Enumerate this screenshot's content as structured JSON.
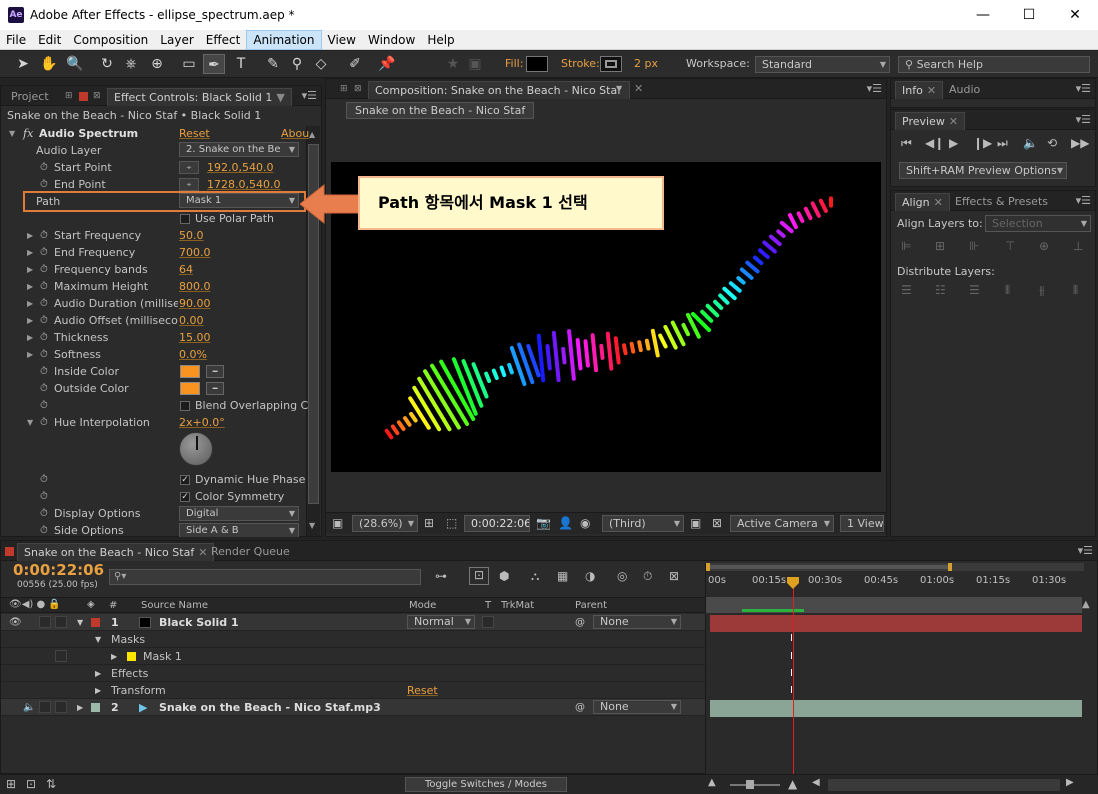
{
  "window": {
    "app_badge": "Ae",
    "title": "Adobe After Effects - ellipse_spectrum.aep *",
    "minimize": "—",
    "maximize": "☐",
    "close": "✕"
  },
  "menu": [
    "File",
    "Edit",
    "Composition",
    "Layer",
    "Effect",
    "Animation",
    "View",
    "Window",
    "Help"
  ],
  "menu_active": "Animation",
  "toolbar": {
    "fill_label": "Fill:",
    "stroke_label": "Stroke:",
    "stroke_width": "2 px",
    "workspace_label": "Workspace:",
    "workspace_value": "Standard",
    "search_placeholder": "Search Help"
  },
  "left_panel": {
    "tab_project": "Project",
    "tab_effect": "Effect Controls: Black Solid 1",
    "breadcrumb": "Snake on the Beach - Nico Staf • Black Solid 1",
    "effect_name": "Audio Spectrum",
    "reset": "Reset",
    "about": "Abou",
    "props": {
      "audio_layer": {
        "label": "Audio Layer",
        "value": "2. Snake on the Be"
      },
      "start_point": {
        "label": "Start Point",
        "value": "192.0,540.0"
      },
      "end_point": {
        "label": "End Point",
        "value": "1728.0,540.0"
      },
      "path": {
        "label": "Path",
        "value": "Mask 1"
      },
      "use_polar": {
        "label": "Use Polar Path"
      },
      "start_freq": {
        "label": "Start Frequency",
        "value": "50.0"
      },
      "end_freq": {
        "label": "End Frequency",
        "value": "700.0"
      },
      "freq_bands": {
        "label": "Frequency bands",
        "value": "64"
      },
      "max_height": {
        "label": "Maximum Height",
        "value": "800.0"
      },
      "audio_duration": {
        "label": "Audio Duration (millisec",
        "value": "90.00"
      },
      "audio_offset": {
        "label": "Audio Offset (millisecon",
        "value": "0.00"
      },
      "thickness": {
        "label": "Thickness",
        "value": "15.00"
      },
      "softness": {
        "label": "Softness",
        "value": "0.0%"
      },
      "inside_color": {
        "label": "Inside Color",
        "color": "#f7931e"
      },
      "outside_color": {
        "label": "Outside Color",
        "color": "#f7931e"
      },
      "blend": {
        "label": "Blend Overlapping C"
      },
      "hue_interp": {
        "label": "Hue Interpolation",
        "value": "2x+0.0°"
      },
      "dynamic_hue": {
        "label": "Dynamic Hue Phase"
      },
      "color_sym": {
        "label": "Color Symmetry"
      },
      "display_options": {
        "label": "Display Options",
        "value": "Digital"
      },
      "side_options": {
        "label": "Side Options",
        "value": "Side A & B"
      }
    }
  },
  "callout": {
    "text": "Path 항목에서  Mask 1 선택"
  },
  "comp_panel": {
    "tab": "Composition: Snake on the Beach - Nico Staf",
    "subtab": "Snake on the Beach - Nico Staf",
    "zoom": "(28.6%)",
    "timecode": "0:00:22:06",
    "resolution": "(Third)",
    "camera": "Active Camera",
    "views": "1 View"
  },
  "right_panels": {
    "info_tab": "Info",
    "audio_tab": "Audio",
    "preview_tab": "Preview",
    "preview_options": "Shift+RAM Preview Options",
    "align_tab": "Align",
    "effects_tab": "Effects & Presets",
    "align_to_label": "Align Layers to:",
    "align_to_value": "Selection",
    "distribute_label": "Distribute Layers:"
  },
  "timeline": {
    "tab": "Snake on the Beach - Nico Staf",
    "render_tab": "Render Queue",
    "timecode": "0:00:22:06",
    "frames": "00556 (25.00 fps)",
    "col_num": "#",
    "col_source": "Source Name",
    "col_mode": "Mode",
    "col_t": "T",
    "col_trkmat": "TrkMat",
    "col_parent": "Parent",
    "ruler": [
      "00s",
      "00:15s",
      "00:30s",
      "00:45s",
      "01:00s",
      "01:15s",
      "01:30s"
    ],
    "layer1": {
      "num": "1",
      "name": "Black Solid 1",
      "mode": "Normal",
      "parent": "None",
      "color": "#c0392b"
    },
    "masks": "Masks",
    "mask1": "Mask 1",
    "effects": "Effects",
    "transform": "Transform",
    "transform_reset": "Reset",
    "layer2": {
      "num": "2",
      "name": "Snake on the Beach - Nico Staf.mp3",
      "parent": "None",
      "color": "#9db8a8"
    },
    "toggle": "Toggle Switches / Modes"
  }
}
